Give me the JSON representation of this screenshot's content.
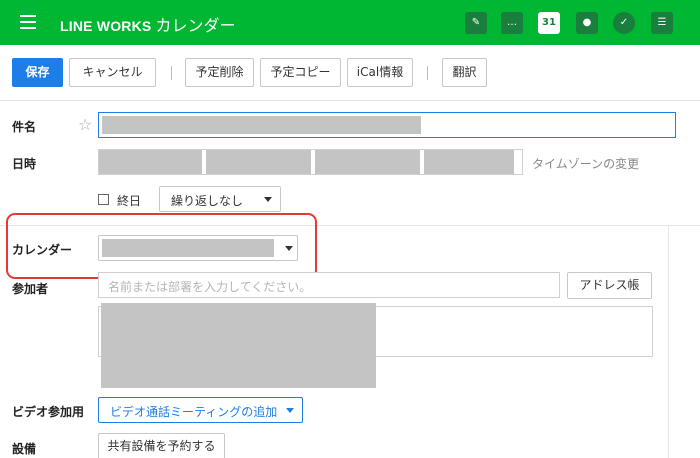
{
  "app": {
    "brand": "LINE WORKS",
    "title": "カレンダー",
    "header_icons": [
      "notes-icon",
      "chat-icon",
      "calendar-icon",
      "contacts-icon",
      "task-check-icon",
      "clipboard-icon"
    ],
    "calendar_icon_day": "31"
  },
  "toolbar": {
    "save_label": "保存",
    "cancel_label": "キャンセル",
    "delete_label": "予定削除",
    "copy_label": "予定コピー",
    "ical_label": "iCal情報",
    "translate_label": "翻訳"
  },
  "form": {
    "title_label": "件名",
    "datetime_label": "日時",
    "timezone_link": "タイムゾーンの変更",
    "allday_label": "終日",
    "repeat_value": "繰り返しなし",
    "calendar_label": "カレンダー",
    "attendees_label": "参加者",
    "attendees_placeholder": "名前または部署を入力してください。",
    "address_book_label": "アドレス帳",
    "video_label": "ビデオ参加用",
    "video_select_value": "ビデオ通話ミーティングの追加",
    "equipment_label": "設備",
    "equipment_button": "共有設備を予約する"
  },
  "colors": {
    "header_green": "#00b733",
    "primary_blue": "#1e7ee8",
    "highlight_red": "#e53935"
  }
}
